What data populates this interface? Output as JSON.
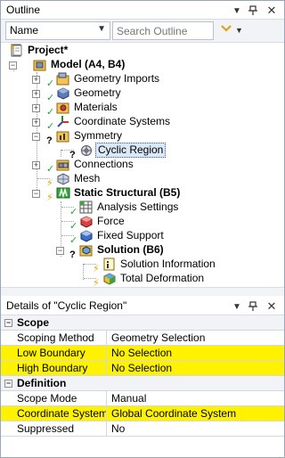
{
  "outline": {
    "title": "Outline",
    "name_select": "Name",
    "search_placeholder": "Search Outline",
    "pin_glyph": "▼",
    "autohide_glyph": "📌",
    "close_glyph": "✕"
  },
  "tree": {
    "items": [
      {
        "label": "Project*"
      },
      {
        "label": "Model (A4, B4)"
      },
      {
        "label": "Geometry Imports"
      },
      {
        "label": "Geometry"
      },
      {
        "label": "Materials"
      },
      {
        "label": "Coordinate Systems"
      },
      {
        "label": "Symmetry"
      },
      {
        "label": "Cyclic Region"
      },
      {
        "label": "Connections"
      },
      {
        "label": "Mesh"
      },
      {
        "label": "Static Structural (B5)"
      },
      {
        "label": "Analysis Settings"
      },
      {
        "label": "Force"
      },
      {
        "label": "Fixed Support"
      },
      {
        "label": "Solution (B6)"
      },
      {
        "label": "Solution Information"
      },
      {
        "label": "Total Deformation"
      }
    ]
  },
  "details": {
    "title": "Details of \"Cyclic Region\"",
    "sections": [
      {
        "name": "Scope",
        "rows": [
          {
            "key": "Scoping Method",
            "value": "Geometry Selection",
            "highlight": false
          },
          {
            "key": "Low Boundary",
            "value": "No Selection",
            "highlight": true
          },
          {
            "key": "High Boundary",
            "value": "No Selection",
            "highlight": true
          }
        ]
      },
      {
        "name": "Definition",
        "rows": [
          {
            "key": "Scope Mode",
            "value": "Manual",
            "highlight": false
          },
          {
            "key": "Coordinate System",
            "value": "Global Coordinate System",
            "highlight": true
          },
          {
            "key": "Suppressed",
            "value": "No",
            "highlight": false
          }
        ]
      }
    ]
  },
  "colors": {
    "highlight": "#fff200",
    "check": "#2e9e3e",
    "bolt": "#e6a400",
    "selection": "#dbe8f8"
  }
}
